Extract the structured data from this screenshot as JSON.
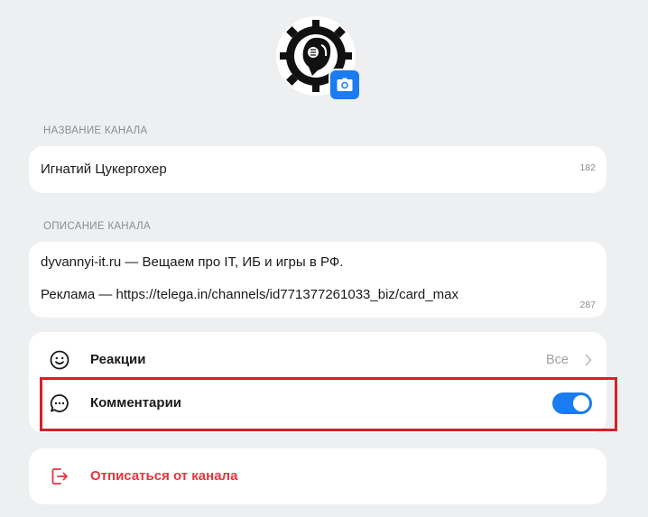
{
  "channel": {
    "avatar_icon": "gear-skull-logo-icon",
    "camera_icon": "camera-icon",
    "name_label": "НАЗВАНИЕ КАНАЛА",
    "name_value": "Игнатий Цукергохер",
    "name_counter": "182",
    "description_label": "ОПИСАНИЕ КАНАЛА",
    "description_line1": "dyvannyi-it.ru — Вещаем про IT, ИБ и игры в РФ.",
    "description_line2": "Реклама — https://telega.in/channels/id771377261033_biz/card_max",
    "description_counter": "287"
  },
  "settings": {
    "reactions": {
      "icon": "smiley-icon",
      "label": "Реакции",
      "value": "Все"
    },
    "comments": {
      "icon": "chat-bubble-icon",
      "label": "Комментарии",
      "enabled": true
    }
  },
  "unsubscribe": {
    "icon": "exit-door-icon",
    "label": "Отписаться от канала"
  },
  "colors": {
    "accent": "#1a7cf0",
    "danger": "#e5343d",
    "highlight": "#d6202a",
    "background": "#eeeff1"
  }
}
